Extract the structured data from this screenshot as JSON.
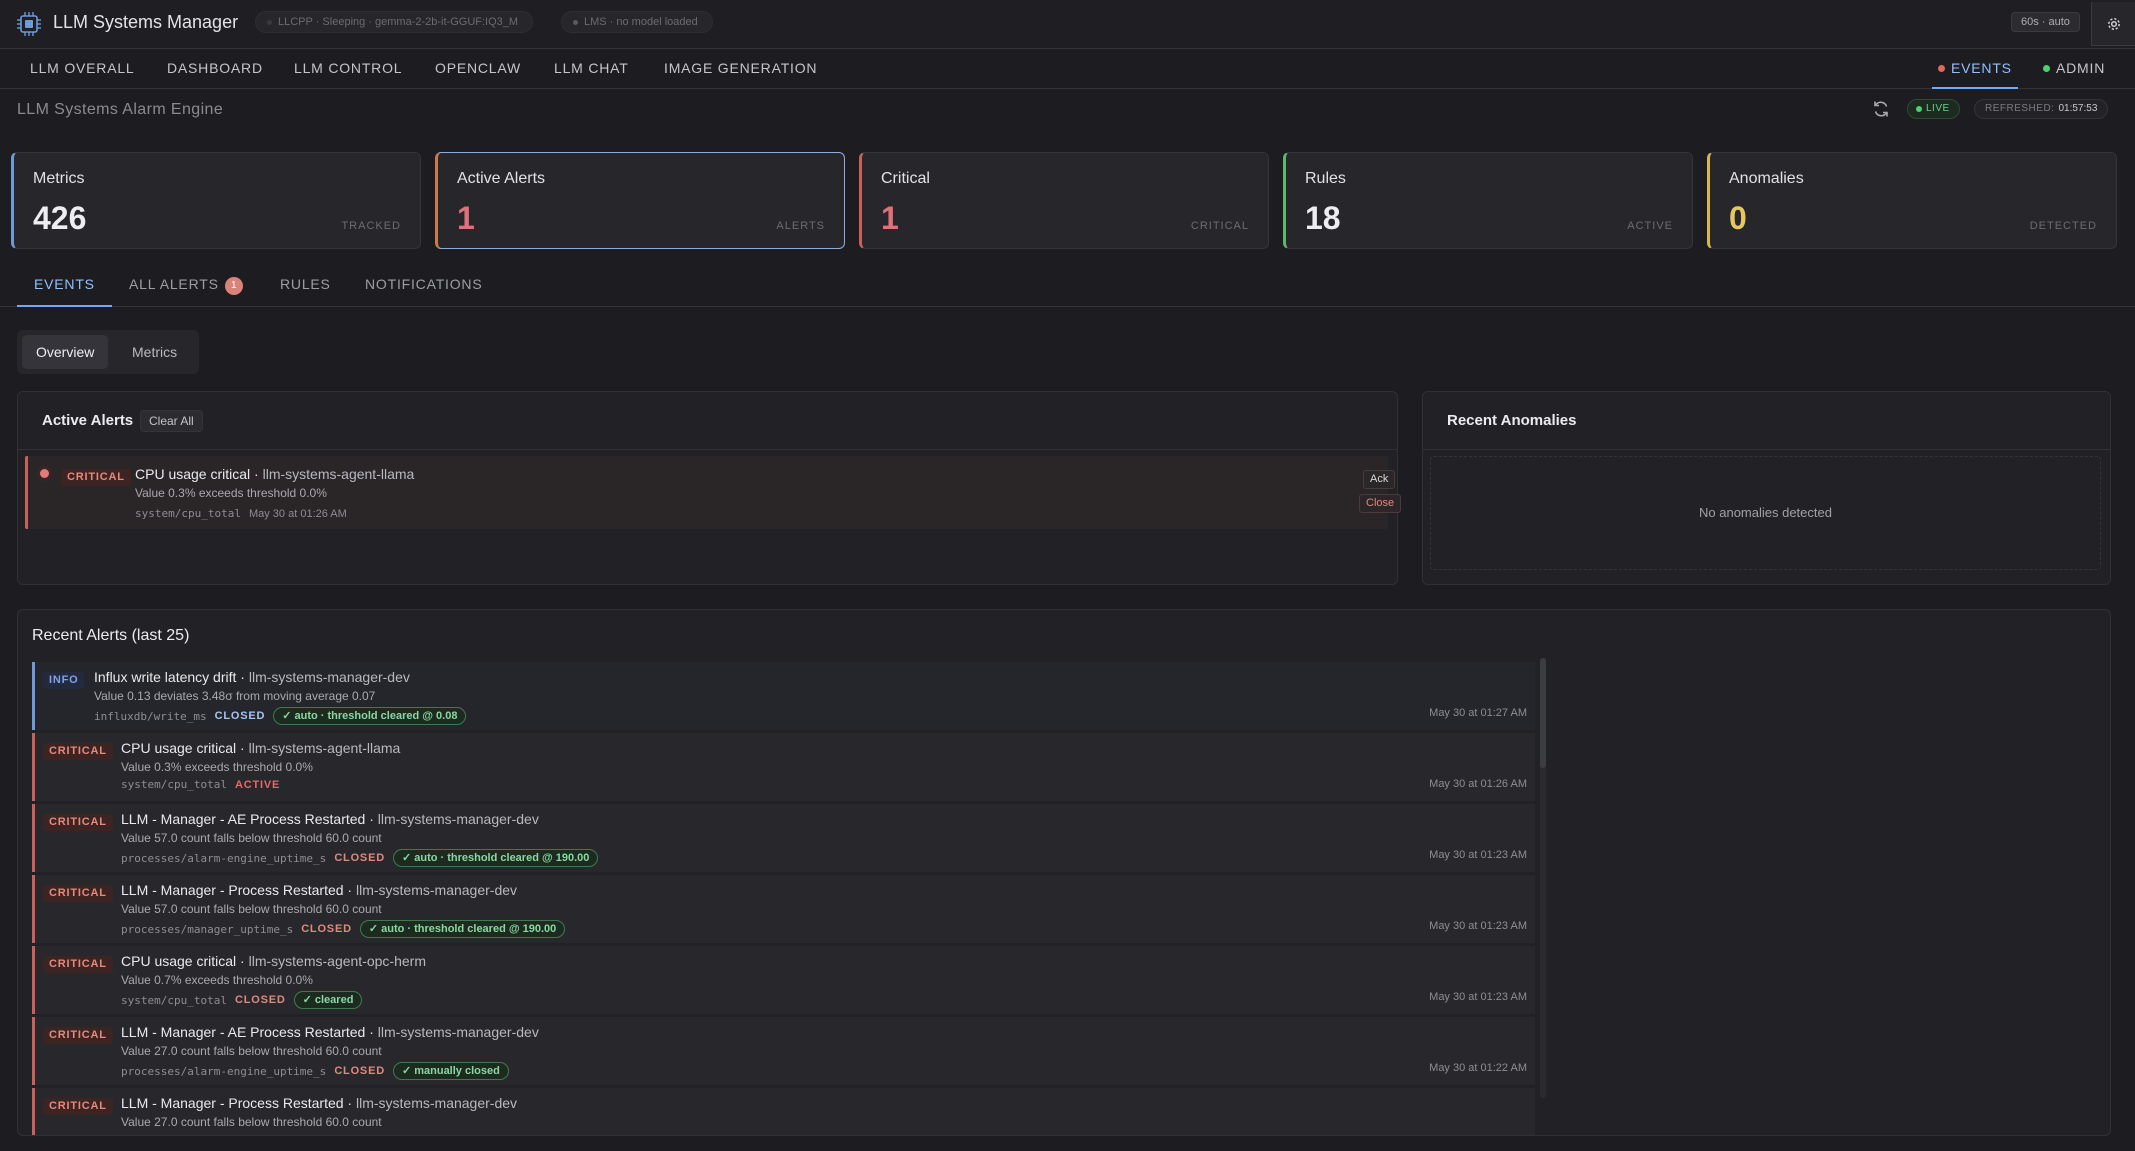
{
  "app": {
    "title": "LLM Systems Manager"
  },
  "status_pills": {
    "llcpp": "LLCPP · Sleeping · gemma-2-2b-it-GGUF:IQ3_M",
    "lms": "LMS · no model loaded"
  },
  "topbar": {
    "refresh_rate": "60s · auto"
  },
  "nav": {
    "items": [
      "LLM OVERALL",
      "DASHBOARD",
      "LLM CONTROL",
      "OPENCLAW",
      "LLM CHAT",
      "IMAGE GENERATION"
    ],
    "events": "EVENTS",
    "admin": "ADMIN",
    "events_dot_color": "#e06a5a",
    "admin_dot_color": "#4fcf74"
  },
  "engine": {
    "title": "LLM Systems Alarm Engine",
    "live": "LIVE",
    "refreshed_label": "REFRESHED:",
    "refreshed_time": "01:57:53"
  },
  "stats": [
    {
      "label": "Metrics",
      "value": "426",
      "caption": "TRACKED",
      "color": "#eeeef2",
      "accent": "#6f9ad8"
    },
    {
      "label": "Active Alerts",
      "value": "1",
      "caption": "ALERTS",
      "color": "#e0707a",
      "accent": "#c97b4a"
    },
    {
      "label": "Critical",
      "value": "1",
      "caption": "CRITICAL",
      "color": "#e0707a",
      "accent": "#c7615a"
    },
    {
      "label": "Rules",
      "value": "18",
      "caption": "ACTIVE",
      "color": "#eeeef2",
      "accent": "#5cb86a"
    },
    {
      "label": "Anomalies",
      "value": "0",
      "caption": "DETECTED",
      "color": "#e6c860",
      "accent": "#d9b84a"
    }
  ],
  "tabs": {
    "events": "EVENTS",
    "all_alerts": "ALL ALERTS",
    "all_alerts_count": "1",
    "rules": "RULES",
    "notifications": "NOTIFICATIONS"
  },
  "view_toggle": {
    "overview": "Overview",
    "metrics": "Metrics"
  },
  "active_alerts": {
    "title": "Active Alerts",
    "clear_all": "Clear All",
    "item": {
      "severity": "CRITICAL",
      "title": "CPU usage critical",
      "host": "llm-systems-agent-llama",
      "description": "Value 0.3% exceeds threshold 0.0%",
      "metric": "system/cpu_total",
      "time": "May 30 at 01:26 AM",
      "ack": "Ack",
      "close": "Close"
    }
  },
  "anomalies": {
    "title": "Recent Anomalies",
    "empty": "No anomalies detected"
  },
  "recent": {
    "title": "Recent Alerts (last 25)",
    "rows": [
      {
        "severity": "INFO",
        "title": "Influx write latency drift",
        "host": "llm-systems-manager-dev",
        "description": "Value 0.13 deviates 3.48σ from moving average 0.07",
        "metric": "influxdb/write_ms",
        "status": "CLOSED",
        "resolution": "✓ auto · threshold cleared @ 0.08",
        "time": "May 30 at 01:27 AM"
      },
      {
        "severity": "CRITICAL",
        "title": "CPU usage critical",
        "host": "llm-systems-agent-llama",
        "description": "Value 0.3% exceeds threshold 0.0%",
        "metric": "system/cpu_total",
        "status": "ACTIVE",
        "resolution": "",
        "time": "May 30 at 01:26 AM"
      },
      {
        "severity": "CRITICAL",
        "title": "LLM - Manager - AE Process Restarted",
        "host": "llm-systems-manager-dev",
        "description": "Value 57.0 count falls below threshold 60.0 count",
        "metric": "processes/alarm-engine_uptime_s",
        "status": "CLOSED",
        "resolution": "✓ auto · threshold cleared @ 190.00",
        "time": "May 30 at 01:23 AM"
      },
      {
        "severity": "CRITICAL",
        "title": "LLM - Manager - Process Restarted",
        "host": "llm-systems-manager-dev",
        "description": "Value 57.0 count falls below threshold 60.0 count",
        "metric": "processes/manager_uptime_s",
        "status": "CLOSED",
        "resolution": "✓ auto · threshold cleared @ 190.00",
        "time": "May 30 at 01:23 AM"
      },
      {
        "severity": "CRITICAL",
        "title": "CPU usage critical",
        "host": "llm-systems-agent-opc-herm",
        "description": "Value 0.7% exceeds threshold 0.0%",
        "metric": "system/cpu_total",
        "status": "CLOSED",
        "resolution": "✓ cleared",
        "time": "May 30 at 01:23 AM"
      },
      {
        "severity": "CRITICAL",
        "title": "LLM - Manager - AE Process Restarted",
        "host": "llm-systems-manager-dev",
        "description": "Value 27.0 count falls below threshold 60.0 count",
        "metric": "processes/alarm-engine_uptime_s",
        "status": "CLOSED",
        "resolution": "✓ manually closed",
        "time": "May 30 at 01:22 AM"
      },
      {
        "severity": "CRITICAL",
        "title": "LLM - Manager - Process Restarted",
        "host": "llm-systems-manager-dev",
        "description": "Value 27.0 count falls below threshold 60.0 count",
        "metric": "",
        "status": "",
        "resolution": "",
        "time": ""
      }
    ]
  }
}
